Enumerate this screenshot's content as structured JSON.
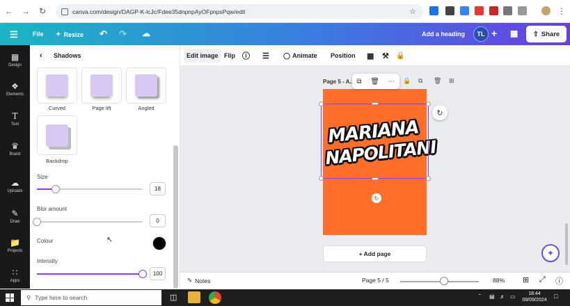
{
  "browser": {
    "url": "canva.com/design/DAGP-K-lcJc/Fdee35dnpnpAyOFpnpsPqw/edit"
  },
  "header": {
    "menu_icon": "hamburger-icon",
    "file_label": "File",
    "resize_label": "Resize",
    "add_heading_label": "Add a heading",
    "avatar_initials": "TL",
    "share_label": "Share"
  },
  "rail": {
    "items": [
      {
        "label": "Design",
        "icon": "design-icon"
      },
      {
        "label": "Elements",
        "icon": "elements-icon"
      },
      {
        "label": "Text",
        "icon": "text-icon"
      },
      {
        "label": "Brand",
        "icon": "brand-icon"
      },
      {
        "label": "Uploads",
        "icon": "uploads-icon"
      },
      {
        "label": "Draw",
        "icon": "draw-icon"
      },
      {
        "label": "Projects",
        "icon": "projects-icon"
      },
      {
        "label": "Apps",
        "icon": "apps-icon"
      }
    ]
  },
  "panel": {
    "title": "Shadows",
    "shadow_options": [
      {
        "label": "Curved"
      },
      {
        "label": "Page lift"
      },
      {
        "label": "Angled"
      },
      {
        "label": "Backdrop"
      }
    ],
    "size_label": "Size",
    "size_value": "18",
    "size_fraction": 0.18,
    "blur_label": "Blur amount",
    "blur_value": "0",
    "blur_fraction": 0.0,
    "colour_label": "Colour",
    "colour_value": "#000000",
    "intensity_label": "Intensity",
    "intensity_value": "100",
    "intensity_fraction": 1.0
  },
  "toolbar": {
    "edit_image_label": "Edit image",
    "flip_label": "Flip",
    "animate_label": "Animate",
    "position_label": "Position"
  },
  "canvas": {
    "page_label": "Page 5 - A...",
    "line1": "MARIANA",
    "line2": "NAPOLITANI",
    "page_color": "#ff6f2a",
    "add_page_label": "+ Add page"
  },
  "footer": {
    "notes_label": "Notes",
    "page_counter": "Page 5 / 5",
    "zoom_value": "88%"
  },
  "taskbar": {
    "search_placeholder": "Type here to search",
    "time": "18:44",
    "date": "08/09/2024"
  }
}
